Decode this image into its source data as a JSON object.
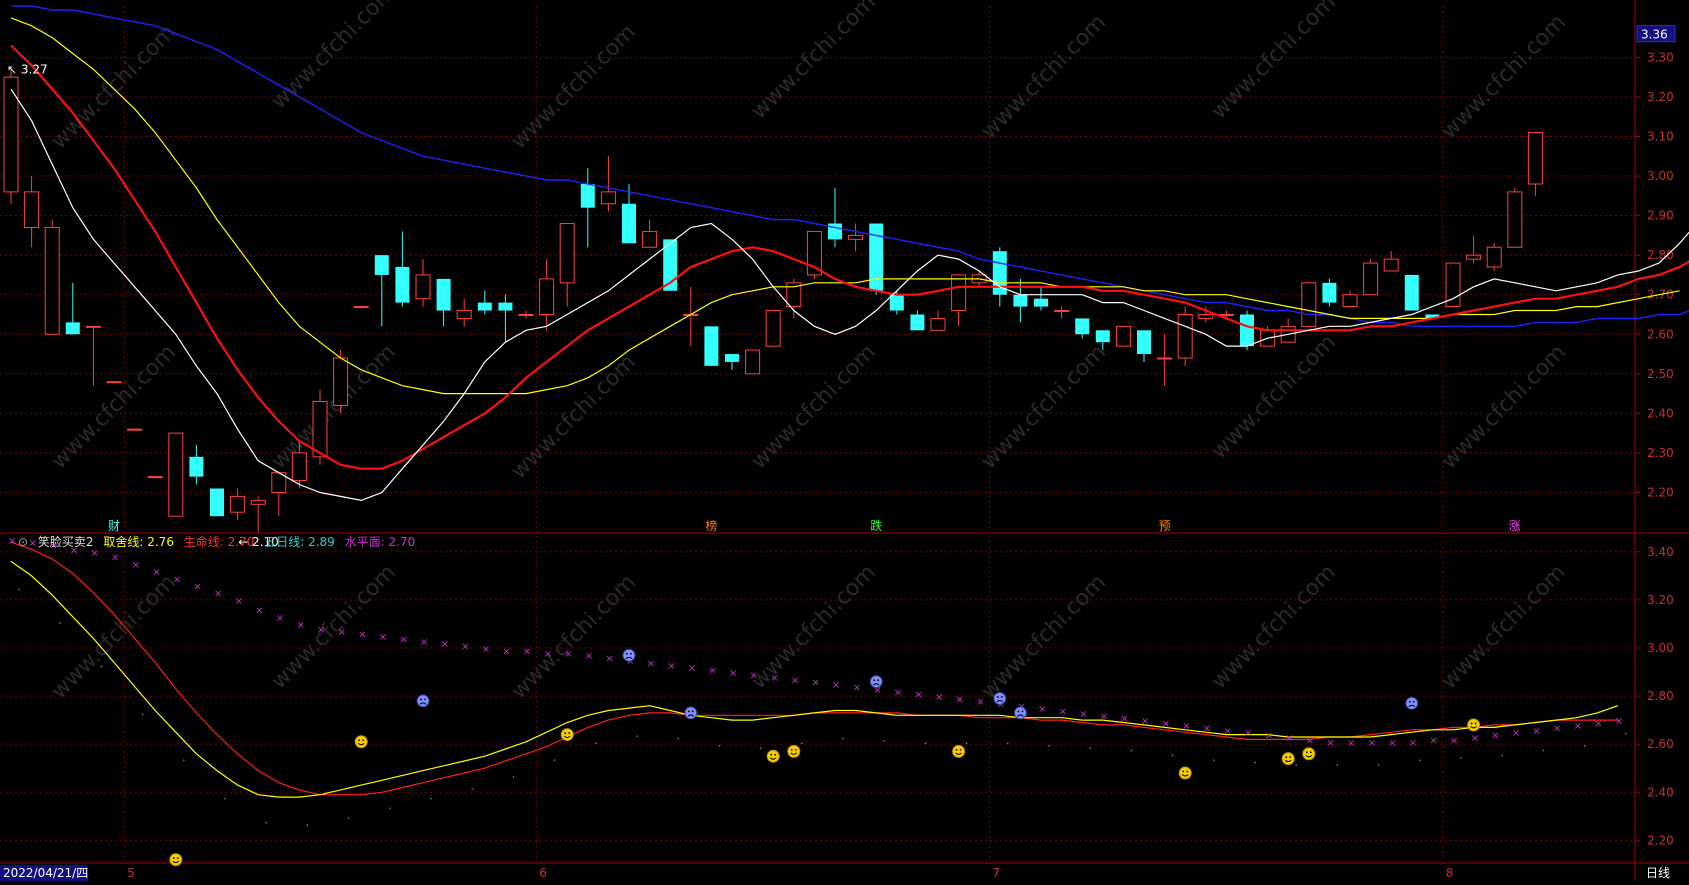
{
  "colors": {
    "bg": "#000000",
    "frame": "#b00000",
    "grid": "#7a0000",
    "up": "#ff4040",
    "down": "#33ffff",
    "ma5": "#ffffff",
    "ma10": "#ff1010",
    "ma20": "#ffff00",
    "ma60": "#2020ff",
    "price_label_bg": "#101080",
    "xmark": "#cc33cc",
    "smile": "#f5d000"
  },
  "price_axis": {
    "ticks": [
      "3.30",
      "3.20",
      "3.10",
      "3.00",
      "2.90",
      "2.80",
      "2.70",
      "2.60",
      "2.50",
      "2.40",
      "2.30",
      "2.20"
    ],
    "current": "3.36",
    "ylim": [
      2.1,
      3.43
    ]
  },
  "ind_axis": {
    "ticks": [
      "3.40",
      "3.20",
      "3.00",
      "2.80",
      "2.60",
      "2.40",
      "2.20"
    ],
    "ylim": [
      2.11,
      3.47
    ]
  },
  "annotations": {
    "high": "3.27",
    "low": "2.10",
    "event_labels": [
      "财",
      "榜",
      "跌",
      "预",
      "涨"
    ]
  },
  "indicator": {
    "name": "笑脸买卖2",
    "items": [
      {
        "label": "取舍线:",
        "value": "2.76",
        "color": "#ffff00"
      },
      {
        "label": "生命线:",
        "value": "2.70",
        "color": "#ff3030"
      },
      {
        "label": "五日线:",
        "value": "2.89",
        "color": "#33cccc"
      },
      {
        "label": "水平面:",
        "value": "2.70",
        "color": "#cc33cc"
      }
    ]
  },
  "date_axis": {
    "start": "2022/04/21/四",
    "months": [
      "5",
      "6",
      "7",
      "8"
    ],
    "period": "日线"
  },
  "watermark": "www.cfchi.com",
  "chart_data": {
    "type": "candlestick",
    "candles": [
      {
        "o": 2.96,
        "h": 3.27,
        "l": 2.93,
        "c": 3.25
      },
      {
        "o": 2.87,
        "h": 3.0,
        "l": 2.82,
        "c": 2.96
      },
      {
        "o": 2.6,
        "h": 2.89,
        "l": 2.6,
        "c": 2.87
      },
      {
        "o": 2.63,
        "h": 2.73,
        "l": 2.6,
        "c": 2.6
      },
      {
        "o": 2.62,
        "h": 2.62,
        "l": 2.47,
        "c": 2.62
      },
      {
        "o": 2.48,
        "h": 2.48,
        "l": 2.48,
        "c": 2.48
      },
      {
        "o": 2.36,
        "h": 2.36,
        "l": 2.36,
        "c": 2.36
      },
      {
        "o": 2.24,
        "h": 2.24,
        "l": 2.24,
        "c": 2.24
      },
      {
        "o": 2.14,
        "h": 2.35,
        "l": 2.14,
        "c": 2.35
      },
      {
        "o": 2.29,
        "h": 2.32,
        "l": 2.22,
        "c": 2.24
      },
      {
        "o": 2.21,
        "h": 2.21,
        "l": 2.14,
        "c": 2.14
      },
      {
        "o": 2.15,
        "h": 2.21,
        "l": 2.13,
        "c": 2.19
      },
      {
        "o": 2.17,
        "h": 2.19,
        "l": 2.1,
        "c": 2.18
      },
      {
        "o": 2.2,
        "h": 2.25,
        "l": 2.14,
        "c": 2.25
      },
      {
        "o": 2.23,
        "h": 2.33,
        "l": 2.21,
        "c": 2.3
      },
      {
        "o": 2.29,
        "h": 2.46,
        "l": 2.27,
        "c": 2.43
      },
      {
        "o": 2.42,
        "h": 2.56,
        "l": 2.4,
        "c": 2.54
      },
      {
        "o": 2.67,
        "h": 2.67,
        "l": 2.67,
        "c": 2.67
      },
      {
        "o": 2.8,
        "h": 2.8,
        "l": 2.62,
        "c": 2.75
      },
      {
        "o": 2.77,
        "h": 2.86,
        "l": 2.67,
        "c": 2.68
      },
      {
        "o": 2.69,
        "h": 2.79,
        "l": 2.67,
        "c": 2.75
      },
      {
        "o": 2.74,
        "h": 2.74,
        "l": 2.62,
        "c": 2.66
      },
      {
        "o": 2.64,
        "h": 2.69,
        "l": 2.62,
        "c": 2.66
      },
      {
        "o": 2.68,
        "h": 2.71,
        "l": 2.65,
        "c": 2.66
      },
      {
        "o": 2.68,
        "h": 2.7,
        "l": 2.58,
        "c": 2.66
      },
      {
        "o": 2.65,
        "h": 2.66,
        "l": 2.64,
        "c": 2.65
      },
      {
        "o": 2.65,
        "h": 2.79,
        "l": 2.61,
        "c": 2.74
      },
      {
        "o": 2.73,
        "h": 2.88,
        "l": 2.67,
        "c": 2.88
      },
      {
        "o": 2.98,
        "h": 3.02,
        "l": 2.82,
        "c": 2.92
      },
      {
        "o": 2.93,
        "h": 3.05,
        "l": 2.91,
        "c": 2.96
      },
      {
        "o": 2.93,
        "h": 2.98,
        "l": 2.83,
        "c": 2.83
      },
      {
        "o": 2.82,
        "h": 2.89,
        "l": 2.82,
        "c": 2.86
      },
      {
        "o": 2.84,
        "h": 2.84,
        "l": 2.71,
        "c": 2.71
      },
      {
        "o": 2.65,
        "h": 2.72,
        "l": 2.57,
        "c": 2.65
      },
      {
        "o": 2.62,
        "h": 2.62,
        "l": 2.52,
        "c": 2.52
      },
      {
        "o": 2.55,
        "h": 2.55,
        "l": 2.51,
        "c": 2.53
      },
      {
        "o": 2.5,
        "h": 2.56,
        "l": 2.5,
        "c": 2.56
      },
      {
        "o": 2.57,
        "h": 2.66,
        "l": 2.57,
        "c": 2.66
      },
      {
        "o": 2.67,
        "h": 2.74,
        "l": 2.64,
        "c": 2.73
      },
      {
        "o": 2.75,
        "h": 2.86,
        "l": 2.74,
        "c": 2.86
      },
      {
        "o": 2.88,
        "h": 2.97,
        "l": 2.82,
        "c": 2.84
      },
      {
        "o": 2.84,
        "h": 2.88,
        "l": 2.81,
        "c": 2.85
      },
      {
        "o": 2.88,
        "h": 2.88,
        "l": 2.7,
        "c": 2.71
      },
      {
        "o": 2.7,
        "h": 2.71,
        "l": 2.65,
        "c": 2.66
      },
      {
        "o": 2.65,
        "h": 2.66,
        "l": 2.61,
        "c": 2.61
      },
      {
        "o": 2.61,
        "h": 2.66,
        "l": 2.61,
        "c": 2.64
      },
      {
        "o": 2.66,
        "h": 2.75,
        "l": 2.62,
        "c": 2.75
      },
      {
        "o": 2.73,
        "h": 2.76,
        "l": 2.72,
        "c": 2.75
      },
      {
        "o": 2.81,
        "h": 2.82,
        "l": 2.67,
        "c": 2.7
      },
      {
        "o": 2.7,
        "h": 2.74,
        "l": 2.63,
        "c": 2.67
      },
      {
        "o": 2.69,
        "h": 2.72,
        "l": 2.66,
        "c": 2.67
      },
      {
        "o": 2.66,
        "h": 2.67,
        "l": 2.64,
        "c": 2.66
      },
      {
        "o": 2.64,
        "h": 2.64,
        "l": 2.59,
        "c": 2.6
      },
      {
        "o": 2.61,
        "h": 2.61,
        "l": 2.56,
        "c": 2.58
      },
      {
        "o": 2.57,
        "h": 2.62,
        "l": 2.57,
        "c": 2.62
      },
      {
        "o": 2.61,
        "h": 2.61,
        "l": 2.53,
        "c": 2.55
      },
      {
        "o": 2.54,
        "h": 2.6,
        "l": 2.47,
        "c": 2.54
      },
      {
        "o": 2.54,
        "h": 2.67,
        "l": 2.52,
        "c": 2.65
      },
      {
        "o": 2.64,
        "h": 2.67,
        "l": 2.63,
        "c": 2.65
      },
      {
        "o": 2.65,
        "h": 2.66,
        "l": 2.64,
        "c": 2.65
      },
      {
        "o": 2.65,
        "h": 2.66,
        "l": 2.56,
        "c": 2.57
      },
      {
        "o": 2.57,
        "h": 2.62,
        "l": 2.57,
        "c": 2.61
      },
      {
        "o": 2.58,
        "h": 2.64,
        "l": 2.58,
        "c": 2.62
      },
      {
        "o": 2.62,
        "h": 2.73,
        "l": 2.62,
        "c": 2.73
      },
      {
        "o": 2.73,
        "h": 2.74,
        "l": 2.67,
        "c": 2.68
      },
      {
        "o": 2.67,
        "h": 2.71,
        "l": 2.67,
        "c": 2.7
      },
      {
        "o": 2.7,
        "h": 2.79,
        "l": 2.7,
        "c": 2.78
      },
      {
        "o": 2.76,
        "h": 2.81,
        "l": 2.76,
        "c": 2.79
      },
      {
        "o": 2.75,
        "h": 2.75,
        "l": 2.66,
        "c": 2.66
      },
      {
        "o": 2.65,
        "h": 2.65,
        "l": 2.64,
        "c": 2.64
      },
      {
        "o": 2.67,
        "h": 2.78,
        "l": 2.67,
        "c": 2.78
      },
      {
        "o": 2.79,
        "h": 2.85,
        "l": 2.78,
        "c": 2.8
      },
      {
        "o": 2.77,
        "h": 2.83,
        "l": 2.76,
        "c": 2.82
      },
      {
        "o": 2.82,
        "h": 2.97,
        "l": 2.82,
        "c": 2.96
      },
      {
        "o": 2.98,
        "h": 3.11,
        "l": 2.95,
        "c": 3.11
      }
    ],
    "ma5": [
      3.22,
      3.14,
      3.03,
      2.92,
      2.84,
      2.78,
      2.72,
      2.66,
      2.6,
      2.52,
      2.45,
      2.36,
      2.28,
      2.25,
      2.22,
      2.2,
      2.19,
      2.18,
      2.2,
      2.26,
      2.32,
      2.38,
      2.45,
      2.53,
      2.58,
      2.61,
      2.62,
      2.65,
      2.68,
      2.71,
      2.75,
      2.79,
      2.83,
      2.87,
      2.88,
      2.84,
      2.79,
      2.72,
      2.66,
      2.62,
      2.6,
      2.62,
      2.66,
      2.71,
      2.76,
      2.8,
      2.79,
      2.76,
      2.72,
      2.7,
      2.7,
      2.7,
      2.7,
      2.68,
      2.68,
      2.66,
      2.64,
      2.62,
      2.6,
      2.57,
      2.57,
      2.59,
      2.6,
      2.61,
      2.62,
      2.62,
      2.63,
      2.64,
      2.65,
      2.67,
      2.69,
      2.72,
      2.74,
      2.73,
      2.72,
      2.71,
      2.72,
      2.73,
      2.75,
      2.76,
      2.78,
      2.83,
      2.89
    ],
    "ma10": [
      3.33,
      3.28,
      3.22,
      3.16,
      3.09,
      3.02,
      2.94,
      2.86,
      2.77,
      2.68,
      2.59,
      2.51,
      2.44,
      2.38,
      2.33,
      2.3,
      2.27,
      2.26,
      2.26,
      2.28,
      2.31,
      2.34,
      2.37,
      2.4,
      2.44,
      2.49,
      2.53,
      2.57,
      2.61,
      2.64,
      2.67,
      2.7,
      2.73,
      2.77,
      2.79,
      2.81,
      2.82,
      2.81,
      2.79,
      2.77,
      2.74,
      2.72,
      2.71,
      2.7,
      2.7,
      2.71,
      2.72,
      2.72,
      2.72,
      2.72,
      2.72,
      2.72,
      2.72,
      2.71,
      2.71,
      2.7,
      2.69,
      2.68,
      2.66,
      2.64,
      2.62,
      2.61,
      2.61,
      2.61,
      2.61,
      2.61,
      2.62,
      2.62,
      2.63,
      2.64,
      2.65,
      2.66,
      2.67,
      2.68,
      2.69,
      2.69,
      2.7,
      2.71,
      2.72,
      2.74,
      2.75,
      2.77,
      2.8
    ],
    "ma20": [
      3.4,
      3.38,
      3.35,
      3.31,
      3.27,
      3.22,
      3.17,
      3.11,
      3.04,
      2.97,
      2.89,
      2.82,
      2.75,
      2.68,
      2.62,
      2.58,
      2.54,
      2.51,
      2.49,
      2.47,
      2.46,
      2.45,
      2.45,
      2.45,
      2.45,
      2.45,
      2.46,
      2.47,
      2.49,
      2.52,
      2.56,
      2.59,
      2.62,
      2.65,
      2.68,
      2.7,
      2.71,
      2.72,
      2.72,
      2.73,
      2.73,
      2.73,
      2.74,
      2.74,
      2.74,
      2.74,
      2.74,
      2.74,
      2.73,
      2.73,
      2.73,
      2.72,
      2.72,
      2.72,
      2.72,
      2.71,
      2.71,
      2.7,
      2.7,
      2.7,
      2.69,
      2.68,
      2.67,
      2.66,
      2.65,
      2.64,
      2.64,
      2.64,
      2.64,
      2.64,
      2.65,
      2.65,
      2.65,
      2.66,
      2.66,
      2.66,
      2.67,
      2.67,
      2.68,
      2.69,
      2.7,
      2.71
    ],
    "ma60": [
      3.43,
      3.43,
      3.42,
      3.42,
      3.41,
      3.4,
      3.39,
      3.38,
      3.36,
      3.34,
      3.32,
      3.29,
      3.26,
      3.23,
      3.2,
      3.17,
      3.14,
      3.11,
      3.09,
      3.07,
      3.05,
      3.04,
      3.03,
      3.02,
      3.01,
      3.0,
      2.99,
      2.99,
      2.98,
      2.97,
      2.96,
      2.95,
      2.94,
      2.93,
      2.92,
      2.91,
      2.9,
      2.89,
      2.89,
      2.88,
      2.87,
      2.86,
      2.85,
      2.84,
      2.83,
      2.82,
      2.81,
      2.79,
      2.78,
      2.77,
      2.76,
      2.75,
      2.74,
      2.73,
      2.72,
      2.71,
      2.7,
      2.69,
      2.68,
      2.68,
      2.67,
      2.66,
      2.66,
      2.65,
      2.65,
      2.64,
      2.63,
      2.63,
      2.62,
      2.62,
      2.62,
      2.62,
      2.62,
      2.62,
      2.63,
      2.63,
      2.63,
      2.64,
      2.64,
      2.64,
      2.65,
      2.65,
      2.67,
      2.7
    ],
    "ind_yellow": [
      3.36,
      3.3,
      3.22,
      3.13,
      3.04,
      2.94,
      2.84,
      2.74,
      2.65,
      2.56,
      2.49,
      2.43,
      2.39,
      2.38,
      2.38,
      2.39,
      2.41,
      2.43,
      2.45,
      2.47,
      2.49,
      2.51,
      2.53,
      2.55,
      2.58,
      2.61,
      2.65,
      2.69,
      2.72,
      2.74,
      2.75,
      2.76,
      2.74,
      2.72,
      2.71,
      2.7,
      2.7,
      2.71,
      2.72,
      2.73,
      2.74,
      2.74,
      2.73,
      2.72,
      2.72,
      2.72,
      2.72,
      2.72,
      2.72,
      2.71,
      2.71,
      2.71,
      2.7,
      2.7,
      2.69,
      2.68,
      2.67,
      2.66,
      2.65,
      2.64,
      2.64,
      2.64,
      2.63,
      2.63,
      2.63,
      2.63,
      2.63,
      2.64,
      2.65,
      2.66,
      2.66,
      2.67,
      2.67,
      2.68,
      2.69,
      2.7,
      2.71,
      2.73,
      2.76
    ],
    "ind_red": [
      3.44,
      3.41,
      3.37,
      3.31,
      3.23,
      3.14,
      3.04,
      2.94,
      2.83,
      2.73,
      2.64,
      2.56,
      2.49,
      2.44,
      2.41,
      2.39,
      2.39,
      2.39,
      2.4,
      2.42,
      2.44,
      2.46,
      2.48,
      2.5,
      2.53,
      2.56,
      2.59,
      2.63,
      2.67,
      2.7,
      2.72,
      2.73,
      2.73,
      2.72,
      2.72,
      2.72,
      2.72,
      2.72,
      2.72,
      2.73,
      2.73,
      2.73,
      2.73,
      2.73,
      2.72,
      2.72,
      2.72,
      2.71,
      2.71,
      2.71,
      2.7,
      2.7,
      2.69,
      2.68,
      2.68,
      2.67,
      2.66,
      2.65,
      2.64,
      2.63,
      2.62,
      2.62,
      2.62,
      2.62,
      2.63,
      2.63,
      2.64,
      2.65,
      2.66,
      2.66,
      2.67,
      2.67,
      2.68,
      2.68,
      2.69,
      2.7,
      2.7,
      2.7,
      2.7
    ],
    "ind_marks": [
      3.45,
      3.44,
      3.43,
      3.41,
      3.4,
      3.38,
      3.35,
      3.32,
      3.29,
      3.26,
      3.23,
      3.2,
      3.16,
      3.13,
      3.1,
      3.08,
      3.07,
      3.06,
      3.05,
      3.04,
      3.03,
      3.02,
      3.01,
      3.0,
      2.99,
      2.99,
      2.98,
      2.98,
      2.97,
      2.96,
      2.95,
      2.94,
      2.93,
      2.92,
      2.91,
      2.9,
      2.89,
      2.88,
      2.87,
      2.86,
      2.85,
      2.84,
      2.83,
      2.82,
      2.81,
      2.8,
      2.79,
      2.78,
      2.77,
      2.76,
      2.75,
      2.74,
      2.73,
      2.72,
      2.71,
      2.7,
      2.69,
      2.68,
      2.67,
      2.66,
      2.65,
      2.64,
      2.63,
      2.62,
      2.61,
      2.61,
      2.61,
      2.61,
      2.61,
      2.62,
      2.62,
      2.63,
      2.64,
      2.65,
      2.66,
      2.67,
      2.68,
      2.69,
      2.7
    ],
    "smiles": [
      {
        "i": 8,
        "v": 2.12
      },
      {
        "i": 17,
        "v": 2.61
      },
      {
        "i": 27,
        "v": 2.64
      },
      {
        "i": 37,
        "v": 2.55
      },
      {
        "i": 38,
        "v": 2.57
      },
      {
        "i": 46,
        "v": 2.57
      },
      {
        "i": 57,
        "v": 2.48
      },
      {
        "i": 62,
        "v": 2.54
      },
      {
        "i": 63,
        "v": 2.56
      },
      {
        "i": 71,
        "v": 2.68
      }
    ],
    "frowns": [
      {
        "i": 20,
        "v": 2.78
      },
      {
        "i": 30,
        "v": 2.97
      },
      {
        "i": 33,
        "v": 2.73
      },
      {
        "i": 42,
        "v": 2.86
      },
      {
        "i": 48,
        "v": 2.79
      },
      {
        "i": 49,
        "v": 2.73
      },
      {
        "i": 68,
        "v": 2.77
      }
    ]
  }
}
